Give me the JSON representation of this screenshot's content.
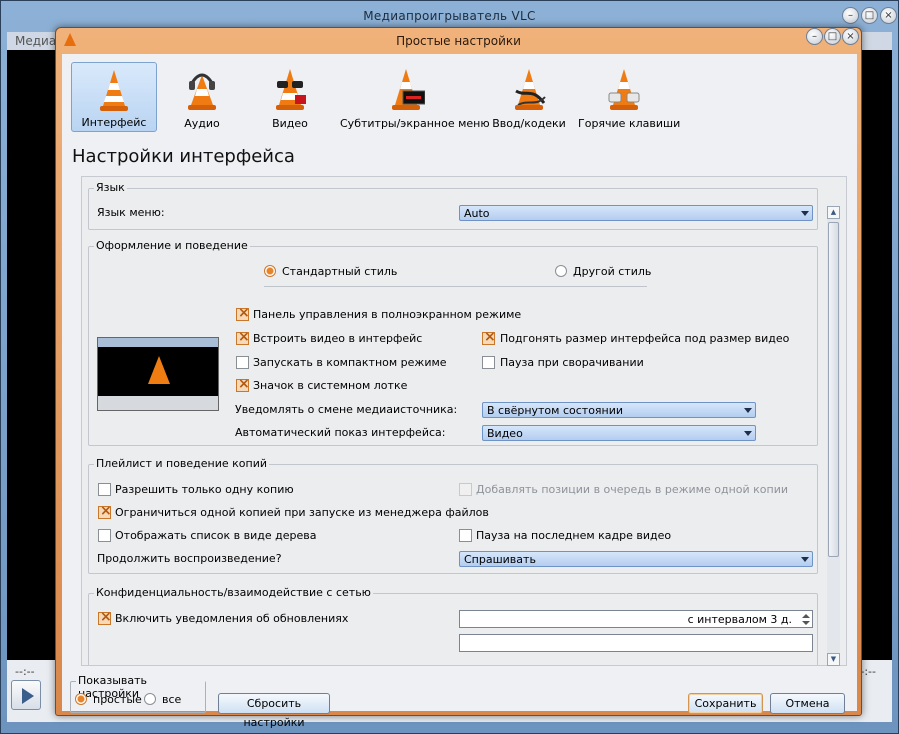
{
  "main_window": {
    "title": "Медиапроигрыватель VLC",
    "menu_first": "Медиа",
    "time_left": "--:--",
    "time_right": "--:--"
  },
  "dialog": {
    "title": "Простые настройки",
    "heading": "Настройки интерфейса"
  },
  "categories": [
    {
      "label": "Интерфейс",
      "icon": "vlc-cone-icon",
      "active": true
    },
    {
      "label": "Аудио",
      "icon": "headphones-cone-icon"
    },
    {
      "label": "Видео",
      "icon": "glasses-cone-icon"
    },
    {
      "label": "Субтитры/экранное меню",
      "icon": "subtitles-cone-icon"
    },
    {
      "label": "Ввод/кодеки",
      "icon": "cable-cone-icon"
    },
    {
      "label": "Горячие клавиши",
      "icon": "hotkeys-cone-icon"
    }
  ],
  "language": {
    "group_title": "Язык",
    "label": "Язык меню:",
    "value": "Auto"
  },
  "look": {
    "group_title": "Оформление и поведение",
    "native_style": "Стандартный стиль",
    "other_style": "Другой стиль",
    "fullscreen_controller": "Панель управления в полноэкранном режиме",
    "embed_video": "Встроить видео в интерфейс",
    "resize_to_video": "Подгонять размер интерфейса под размер видео",
    "compact_mode": "Запускать в компактном режиме",
    "pause_minimized": "Пауза при сворачивании",
    "systray_icon": "Значок в системном лотке",
    "notify_label": "Уведомлять о смене медиаисточника:",
    "notify_value": "В свёрнутом состоянии",
    "autoraise_label": "Автоматический показ интерфейса:",
    "autoraise_value": "Видео"
  },
  "playlist": {
    "group_title": "Плейлист и поведение копий",
    "one_instance": "Разрешить только одну копию",
    "enqueue_one_instance": "Добавлять позиции в очередь в режиме одной копии",
    "one_instance_file_manager": "Ограничиться одной копией при запуске из менеджера файлов",
    "tree_view": "Отображать список в виде дерева",
    "pause_last_frame": "Пауза на последнем кадре видео",
    "continue_label": "Продолжить воспроизведение?",
    "continue_value": "Спрашивать"
  },
  "privacy": {
    "group_title": "Конфиденциальность/взаимодействие с сетью",
    "updates_label": "Включить уведомления об обновлениях",
    "updates_interval": "с интервалом 3 д."
  },
  "footer": {
    "show_settings_title": "Показывать настройки",
    "simple": "простые",
    "all": "все",
    "reset": "Сбросить настройки",
    "save": "Сохранить",
    "cancel": "Отмена"
  }
}
